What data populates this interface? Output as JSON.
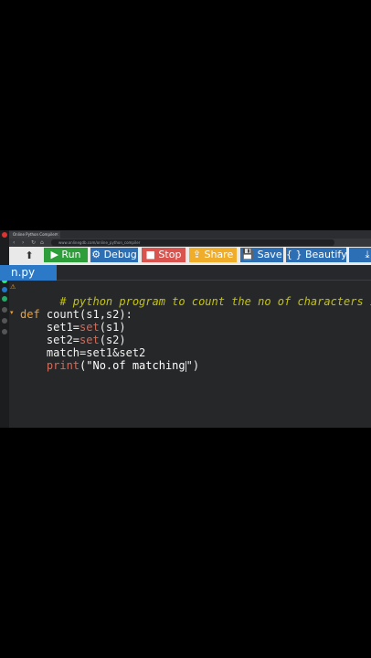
{
  "browser": {
    "tab_title": "Online Python Compiler",
    "address": "www.onlinegdb.com/online_python_compiler",
    "tab_close": "×",
    "back": "‹",
    "forward": "›",
    "reload": "↻",
    "home": "⌂"
  },
  "toolbar": {
    "logo": "⬆",
    "run_label": "▶ Run",
    "debug_label": "⚙ Debug",
    "stop_label": "■ Stop",
    "share_label": "⇪ Share",
    "save_label": "💾 Save",
    "beautify_label": "{ } Beautify",
    "download_label": "⤓"
  },
  "file_tab": {
    "label": "n.py"
  },
  "code": {
    "comment": "# python program to count the no of characters in a pair",
    "def_kw": "def",
    "def_rest": " count(s1,s2):",
    "set1_a": "    set1=",
    "set1_fn": "set",
    "set1_b": "(s1)",
    "set2_a": "    set2=",
    "set2_fn": "set",
    "set2_b": "(s2)",
    "match": "    match=set1&set2",
    "print_fn": "    print",
    "print_a": "(\"No.of matching",
    "print_b": "\")"
  },
  "colors": {
    "run": "#2e9e3a",
    "debug": "#2d6fb5",
    "stop": "#d9534f",
    "share": "#f0ad2a",
    "file_tab": "#2c79c7",
    "comment": "#c5c500",
    "keyword": "#f0a030"
  }
}
